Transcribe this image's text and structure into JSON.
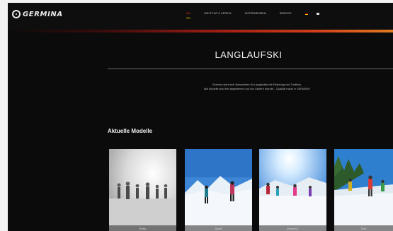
{
  "header": {
    "logo_text": "GERMINA",
    "nav": [
      {
        "label": "SKI",
        "active": true
      },
      {
        "label": "WELTCUP & VEREIN",
        "active": false
      },
      {
        "label": "UNTERNEHMEN",
        "active": false
      },
      {
        "label": "SERVICE",
        "active": false
      }
    ],
    "languages": [
      "de",
      "en"
    ]
  },
  "main": {
    "title": "LANGLAUFSKI",
    "intro_line1": "Germina steht seit Jahrzehnten für Langlaufski mit Erfahrung und Tradition.",
    "intro_line2": "Alle Modelle sind fein abgestimmt und von Läufern erprobt – Qualität made in GERMANY",
    "section_heading": "Aktuelle Modelle"
  },
  "cards": [
    {
      "caption": "Retro"
    },
    {
      "caption": "Sport"
    },
    {
      "caption": "Kinder/Jr"
    },
    {
      "caption": "Tour"
    }
  ],
  "colors": {
    "accent_active": "#ff3a2a",
    "underline": "#e6b800",
    "background": "#0b0b0b"
  }
}
